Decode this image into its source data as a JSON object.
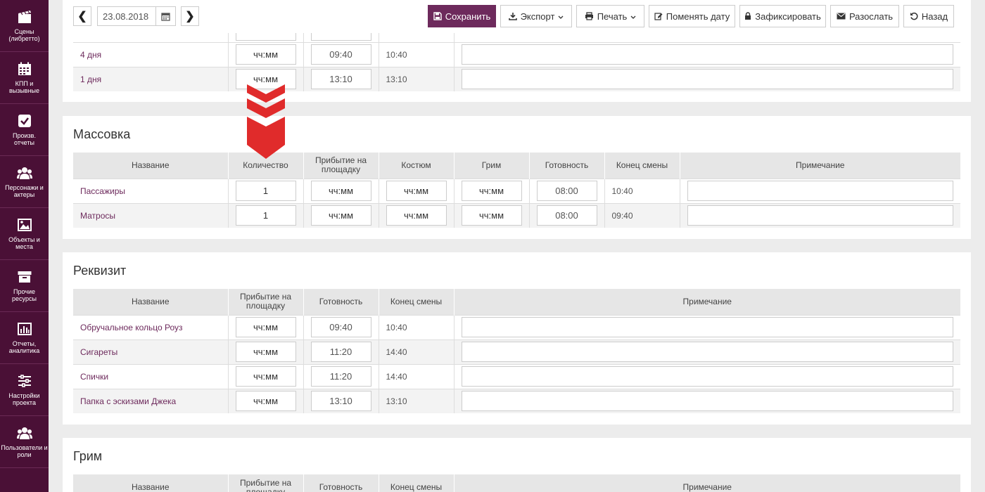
{
  "sidebar": [
    {
      "label": "Сцены\n(либретто)",
      "icon": "film-icon"
    },
    {
      "label": "КПП и\nвызывные",
      "icon": "calendar-icon"
    },
    {
      "label": "Произв.\nотчеты",
      "icon": "check-icon"
    },
    {
      "label": "Персонажи и\nактеры",
      "icon": "users-icon"
    },
    {
      "label": "Объекты и\nместа",
      "icon": "image-icon"
    },
    {
      "label": "Прочие\nресурсы",
      "icon": "archive-icon"
    },
    {
      "label": "Отчеты,\nаналитика",
      "icon": "bar-chart-icon"
    },
    {
      "label": "Настройки\nпроекта",
      "icon": "sliders-icon"
    },
    {
      "label": "Пользователи и\nроли",
      "icon": "users-icon"
    }
  ],
  "toolbar": {
    "date": "23.08.2018",
    "prev": "❮",
    "next": "❯",
    "save": "Сохранить",
    "export": "Экспорт",
    "print": "Печать",
    "change_date": "Поменять дату",
    "lock": "Зафиксировать",
    "send": "Разослать",
    "back": "Назад"
  },
  "top_rows": [
    {
      "name": "4 дня",
      "arrival": "чч:мм",
      "ready": "09:40",
      "end": "10:40"
    },
    {
      "name": "1 дня",
      "arrival": "чч:мм",
      "ready": "13:10",
      "end": "13:10"
    }
  ],
  "extras": {
    "title": "Массовка",
    "headers": [
      "Название",
      "Количество",
      "Прибытие на площадку",
      "Костюм",
      "Грим",
      "Готовность",
      "Конец смены",
      "Примечание"
    ],
    "rows": [
      {
        "name": "Пассажиры",
        "qty": "1",
        "arrival": "чч:мм",
        "costume": "чч:мм",
        "makeup": "чч:мм",
        "ready": "08:00",
        "end": "10:40"
      },
      {
        "name": "Матросы",
        "qty": "1",
        "arrival": "чч:мм",
        "costume": "чч:мм",
        "makeup": "чч:мм",
        "ready": "08:00",
        "end": "09:40"
      }
    ]
  },
  "props": {
    "title": "Реквизит",
    "headers": [
      "Название",
      "Прибытие на площадку",
      "Готовность",
      "Конец смены",
      "Примечание"
    ],
    "rows": [
      {
        "name": "Обручальное кольцо Роуз",
        "arrival": "чч:мм",
        "ready": "09:40",
        "end": "10:40"
      },
      {
        "name": "Сигареты",
        "arrival": "чч:мм",
        "ready": "11:20",
        "end": "14:40"
      },
      {
        "name": "Спички",
        "arrival": "чч:мм",
        "ready": "11:20",
        "end": "14:40"
      },
      {
        "name": "Папка с эскизами Джека",
        "arrival": "чч:мм",
        "ready": "13:10",
        "end": "13:10"
      }
    ]
  },
  "makeup": {
    "title": "Грим",
    "headers": [
      "Название",
      "Прибытие на площадку",
      "Готовность",
      "Конец смены",
      "Примечание"
    ]
  },
  "colors": {
    "sidebar": "#4a1036",
    "accent": "#6d2a5c",
    "arrow": "#e02b2b"
  }
}
